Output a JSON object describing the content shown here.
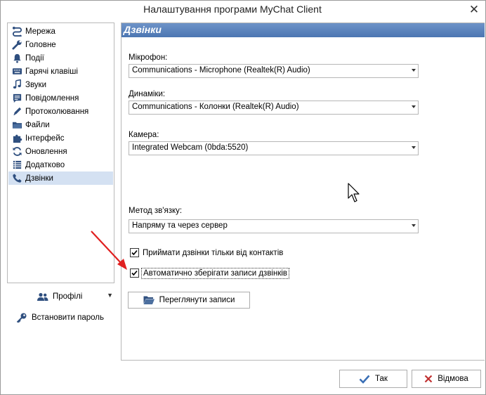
{
  "window": {
    "title": "Налаштування програми MyChat Client"
  },
  "sidebar": {
    "items": [
      {
        "label": "Мережа",
        "icon": "network-icon"
      },
      {
        "label": "Головне",
        "icon": "wrench-icon"
      },
      {
        "label": "Події",
        "icon": "bell-icon"
      },
      {
        "label": "Гарячі клавіші",
        "icon": "keyboard-icon"
      },
      {
        "label": "Звуки",
        "icon": "music-note-icon"
      },
      {
        "label": "Повідомлення",
        "icon": "message-icon"
      },
      {
        "label": "Протоколювання",
        "icon": "pencil-icon"
      },
      {
        "label": "Файли",
        "icon": "folder-icon"
      },
      {
        "label": "Інтерфейс",
        "icon": "puzzle-icon"
      },
      {
        "label": "Оновлення",
        "icon": "refresh-icon"
      },
      {
        "label": "Додатково",
        "icon": "list-icon"
      },
      {
        "label": "Дзвінки",
        "icon": "phone-icon"
      }
    ],
    "selected": "Дзвінки"
  },
  "bottom_left": {
    "profiles": "Профілі",
    "set_password": "Встановити пароль"
  },
  "panel": {
    "title": "Дзвінки",
    "microphone": {
      "label": "Мікрофон:",
      "value": "Communications - Microphone (Realtek(R) Audio)"
    },
    "speakers": {
      "label": "Динаміки:",
      "value": "Communications - Колонки (Realtek(R) Audio)"
    },
    "camera": {
      "label": "Камера:",
      "value": "Integrated Webcam (0bda:5520)"
    },
    "method": {
      "label": "Метод зв'язку:",
      "value": "Напряму та через сервер"
    },
    "accept_only_contacts": {
      "label": "Приймати дзвінки тільки від контактів",
      "checked": true
    },
    "auto_save": {
      "label": "Автоматично зберігати записи дзвінків",
      "checked": true
    },
    "view_records": "Переглянути записи"
  },
  "footer": {
    "ok": "Так",
    "cancel": "Відмова"
  },
  "colors": {
    "header": "#4c76b2",
    "selected": "#d4e1f2",
    "ok_check": "#3a6fb5",
    "cancel_x": "#c03030",
    "arrow": "#e02020"
  }
}
